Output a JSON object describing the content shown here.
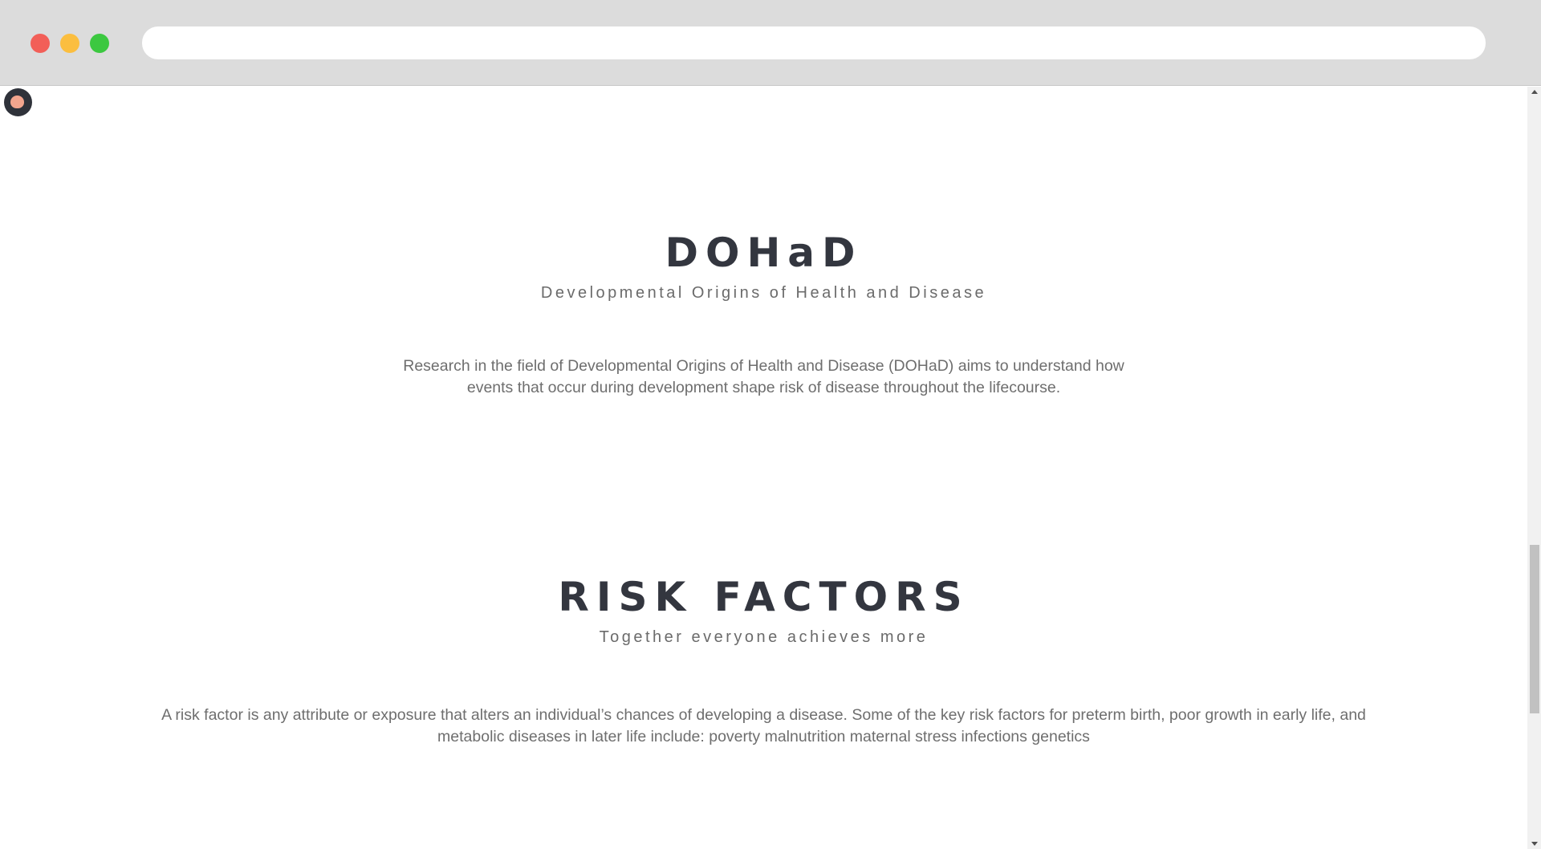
{
  "browser": {
    "url": ""
  },
  "sections": [
    {
      "title": "DOHaD",
      "subtitle": "Developmental Origins of Health and Disease",
      "body": "Research in the field of Developmental Origins of Health and Disease (DOHaD) aims to understand how events that occur during development shape risk of disease throughout the lifecourse."
    },
    {
      "title": "RISK FACTORS",
      "subtitle": "Together everyone achieves more",
      "body": "A risk factor is any attribute or exposure that alters an individual’s chances of developing a disease. Some of the key risk factors for preterm birth, poor growth in early life, and metabolic diseases in later life include: poverty malnutrition maternal stress infections genetics"
    }
  ],
  "colors": {
    "heading": "#33363f",
    "text": "#6e6e6e",
    "logo_bg": "#2f323a",
    "logo_fg": "#f3a58e"
  },
  "icons": {
    "logo": "fetus-logo-icon"
  }
}
